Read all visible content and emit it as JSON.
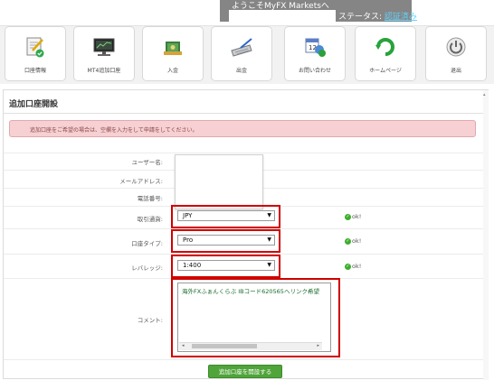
{
  "header": {
    "welcome": "ようこそMyFX Marketsへ",
    "status_label": "ステータス:",
    "status_value": "認証済み"
  },
  "nav": {
    "items": [
      {
        "label": "口座情報",
        "icon": "document-edit-icon"
      },
      {
        "label": "MT4追加口座",
        "icon": "monitor-icon"
      },
      {
        "label": "入金",
        "icon": "deposit-icon"
      },
      {
        "label": "出金",
        "icon": "keyboard-pen-icon"
      },
      {
        "label": "お問い合わせ",
        "icon": "calendar-contact-icon"
      },
      {
        "label": "ホームページ",
        "icon": "green-arrow-icon"
      },
      {
        "label": "退出",
        "icon": "power-icon"
      }
    ]
  },
  "panel": {
    "title": "追加口座開設",
    "notice": "追加口座をご希望の場合は、空欄を入力をして申請をしてください。"
  },
  "form": {
    "username_label": "ユーザー名:",
    "email_label": "メールアドレス:",
    "phone_label": "電話番号:",
    "currency_label": "取引通貨:",
    "currency_value": "JPY",
    "account_type_label": "口座タイプ:",
    "account_type_value": "Pro",
    "leverage_label": "レバレッジ:",
    "leverage_value": "1:400",
    "comment_label": "コメント:",
    "comment_value": "海外FXふぁんくらぶ IBコード620565ヘリンク希望",
    "ok_text": "ok!",
    "submit_label": "追加口座を開設する"
  },
  "colors": {
    "header_bg": "#858585",
    "status_accent": "#63d3ff",
    "alert_bg": "#f6d0d2",
    "highlight_border": "#d00000",
    "submit_bg": "#4fa43a",
    "ok_icon": "#3cae2e"
  }
}
